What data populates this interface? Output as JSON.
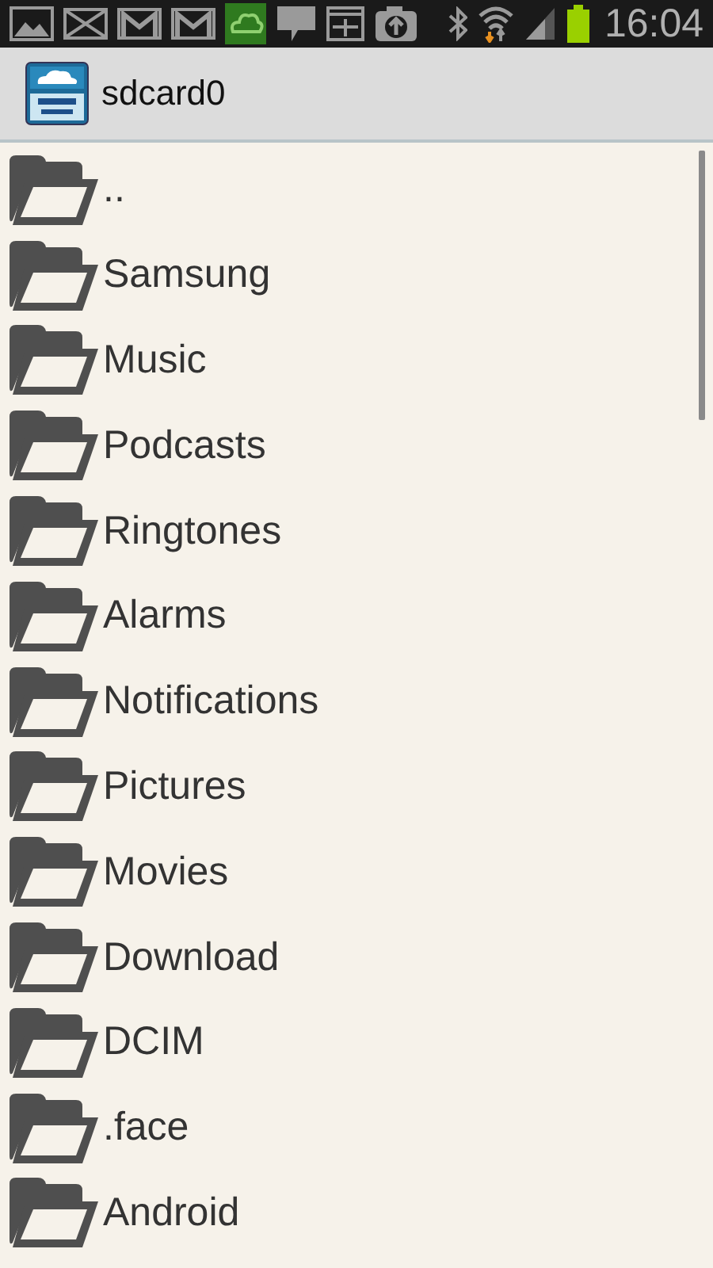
{
  "status_bar": {
    "time": "16:04"
  },
  "app_bar": {
    "title": "sdcard0"
  },
  "folders": [
    {
      "name": ".."
    },
    {
      "name": "Samsung"
    },
    {
      "name": "Music"
    },
    {
      "name": "Podcasts"
    },
    {
      "name": "Ringtones"
    },
    {
      "name": "Alarms"
    },
    {
      "name": "Notifications"
    },
    {
      "name": "Pictures"
    },
    {
      "name": "Movies"
    },
    {
      "name": "Download"
    },
    {
      "name": "DCIM"
    },
    {
      "name": ".face"
    },
    {
      "name": "Android"
    }
  ]
}
